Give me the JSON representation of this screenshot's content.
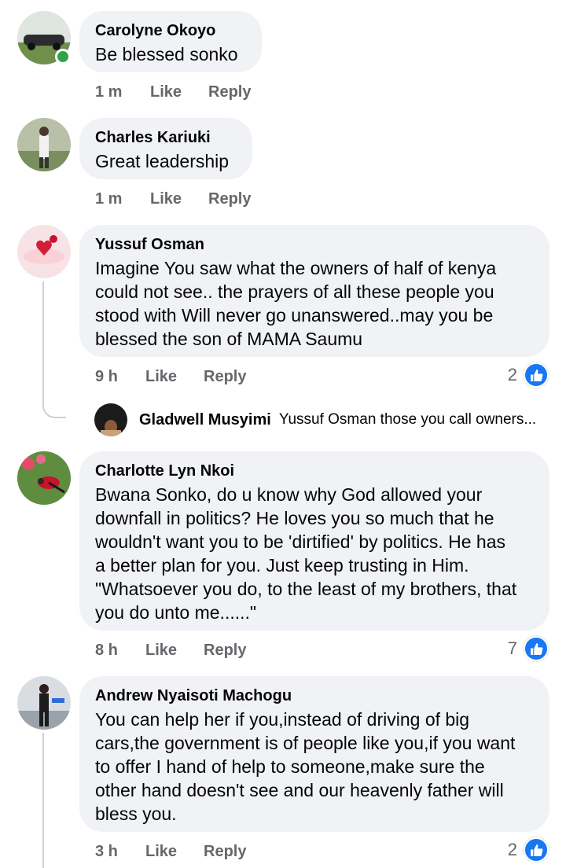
{
  "comments": [
    {
      "author": "Carolyne Okoyo",
      "text": "Be blessed sonko",
      "time": "1 m",
      "like": "Like",
      "reply": "Reply",
      "online": true
    },
    {
      "author": "Charles Kariuki",
      "text": "Great leadership",
      "time": "1 m",
      "like": "Like",
      "reply": "Reply"
    },
    {
      "author": "Yussuf Osman",
      "text": "Imagine You saw what the owners of half of kenya\ncould not see.. the prayers of all these people you\nstood with Will never go unanswered..may you be\nblessed the son of MAMA Saumu",
      "time": "9 h",
      "like": "Like",
      "reply": "Reply",
      "reactions": "2"
    },
    {
      "author": "Charlotte Lyn Nkoi",
      "text": "Bwana Sonko, do u know why God allowed your\ndownfall in politics? He loves you so much that he\nwouldn't want you to be 'dirtified' by politics. He has\na better plan for you. Just keep trusting in Him.\n\"Whatsoever you do, to the least of my brothers, that\nyou do unto me......\"",
      "time": "8 h",
      "like": "Like",
      "reply": "Reply",
      "reactions": "7"
    },
    {
      "author": "Andrew Nyaisoti Machogu",
      "text": "You can help her if you,instead of driving of big\ncars,the government is of people like you,if you want\nto offer I hand of help to someone,make sure the\nother hand doesn't see and our heavenly father will\nbless you.",
      "time": "3 h",
      "like": "Like",
      "reply": "Reply",
      "reactions": "2"
    }
  ],
  "reply_preview": {
    "author": "Gladwell Musyimi",
    "text": "Yussuf Osman those you call owners..."
  },
  "colors": {
    "bubble": "#f0f2f5",
    "meta": "#65676b",
    "like_blue": "#1877f2",
    "online": "#31a24c"
  },
  "icons": {
    "reaction": "like-thumb-icon"
  }
}
